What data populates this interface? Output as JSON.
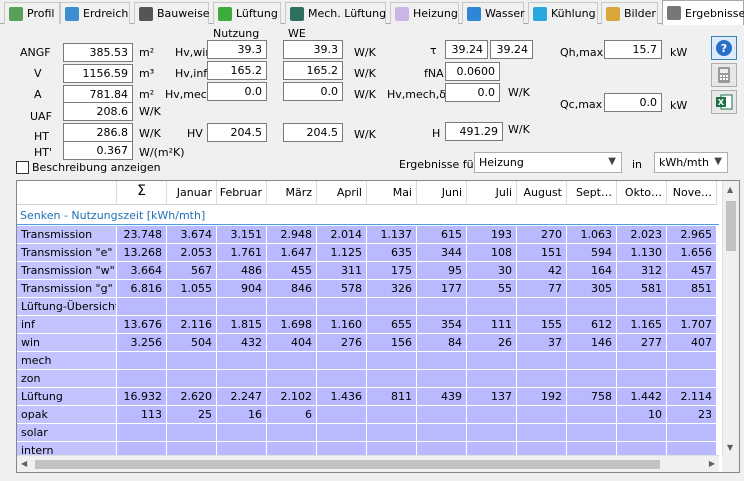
{
  "tabs": [
    {
      "name": "tab-profil",
      "label": "Profil",
      "icon": "profile-icon",
      "color": "#5aa05a"
    },
    {
      "name": "tab-erdreich",
      "label": "Erdreich",
      "icon": "earth-icon",
      "color": "#3e8ecf"
    },
    {
      "name": "tab-bauweise",
      "label": "Bauweise",
      "icon": "brick-wall-icon",
      "color": "#555555"
    },
    {
      "name": "tab-lueftung",
      "label": "Lüftung",
      "icon": "ventilation-icon",
      "color": "#3cab3c"
    },
    {
      "name": "tab-mech-lueftung",
      "label": "Mech. Lüftung",
      "icon": "fan-icon",
      "color": "#2f6f5f"
    },
    {
      "name": "tab-heizung",
      "label": "Heizung",
      "icon": "radiator-icon",
      "color": "#c9b6e6"
    },
    {
      "name": "tab-wasser",
      "label": "Wasser",
      "icon": "water-drop-icon",
      "color": "#2f86d6"
    },
    {
      "name": "tab-kuehlung",
      "label": "Kühlung",
      "icon": "snowflake-icon",
      "color": "#29a7e0"
    },
    {
      "name": "tab-bilder",
      "label": "Bilder",
      "icon": "palette-icon",
      "color": "#d9a63a"
    },
    {
      "name": "tab-ergebnisse",
      "label": "Ergebnisse",
      "icon": "calculator-icon",
      "color": "#777777",
      "active": true
    }
  ],
  "props": {
    "angf_label": "ANGF",
    "angf_value": "385.53",
    "angf_unit": "m²",
    "v_label": "V",
    "v_value": "1156.59",
    "v_unit": "m³",
    "a_label": "A",
    "a_value": "781.84",
    "a_unit": "m²",
    "uaf_label": "UAF",
    "uaf_value": "208.6",
    "uaf_unit": "W/K",
    "ht_label": "HT",
    "ht_value": "286.8",
    "ht_unit": "W/K",
    "htp_label": "HT'",
    "htp_value": "0.367",
    "htp_unit": "W/(m²K)"
  },
  "hv": {
    "nutzung_header": "Nutzung",
    "we_header": "WE",
    "win_label": "Hv,win",
    "win_nutzung": "39.3",
    "win_we": "39.3",
    "win_unit": "W/K",
    "inf_label": "Hv,inf",
    "inf_nutzung": "165.2",
    "inf_we": "165.2",
    "inf_unit": "W/K",
    "mech_label": "Hv,mech",
    "mech_nutzung": "0.0",
    "mech_we": "0.0",
    "mech_unit": "W/K",
    "hv_label": "HV",
    "hv_nutzung": "204.5",
    "hv_we": "204.5",
    "hv_unit": "W/K"
  },
  "right": {
    "tau_label": "τ",
    "tau_value1": "39.24",
    "tau_value2": "39.24",
    "fna_label": "fNA",
    "fna_value": "0.0600",
    "hvmech_label": "Hv,mech,δ",
    "hvmech_value": "0.0",
    "hvmech_unit": "W/K",
    "h_label": "H",
    "h_value": "491.29",
    "h_unit": "W/K",
    "qh_label": "Qh,max",
    "qh_value": "15.7",
    "qh_unit": "kW",
    "qc_label": "Qc,max",
    "qc_value": "0.0",
    "qc_unit": "kW"
  },
  "controls": {
    "beschreibung_label": "Beschreibung anzeigen",
    "ergebnisse_label": "Ergebnisse für",
    "ergebnisse_value": "Heizung",
    "in_label": "in",
    "unit_value": "kWh/mth"
  },
  "table": {
    "columns": [
      "Σ",
      "Januar",
      "Februar",
      "März",
      "April",
      "Mai",
      "Juni",
      "Juli",
      "August",
      "Sept…",
      "Okto…",
      "Nove…"
    ],
    "section": "Senken - Nutzungszeit  [kWh/mth]",
    "rows": [
      {
        "name": "Transmission",
        "values": [
          "23.748",
          "3.674",
          "3.151",
          "2.948",
          "2.014",
          "1.137",
          "615",
          "193",
          "270",
          "1.063",
          "2.023",
          "2.965"
        ]
      },
      {
        "name": "Transmission \"e\"",
        "values": [
          "13.268",
          "2.053",
          "1.761",
          "1.647",
          "1.125",
          "635",
          "344",
          "108",
          "151",
          "594",
          "1.130",
          "1.656"
        ]
      },
      {
        "name": "Transmission \"w\"",
        "values": [
          "3.664",
          "567",
          "486",
          "455",
          "311",
          "175",
          "95",
          "30",
          "42",
          "164",
          "312",
          "457"
        ]
      },
      {
        "name": "Transmission \"g\"",
        "values": [
          "6.816",
          "1.055",
          "904",
          "846",
          "578",
          "326",
          "177",
          "55",
          "77",
          "305",
          "581",
          "851"
        ]
      },
      {
        "name": "Lüftung-Übersicht",
        "values": [
          "",
          "",
          "",
          "",
          "",
          "",
          "",
          "",
          "",
          "",
          "",
          ""
        ]
      },
      {
        "name": "inf",
        "values": [
          "13.676",
          "2.116",
          "1.815",
          "1.698",
          "1.160",
          "655",
          "354",
          "111",
          "155",
          "612",
          "1.165",
          "1.707"
        ]
      },
      {
        "name": "win",
        "values": [
          "3.256",
          "504",
          "432",
          "404",
          "276",
          "156",
          "84",
          "26",
          "37",
          "146",
          "277",
          "407"
        ]
      },
      {
        "name": "mech",
        "values": [
          "",
          "",
          "",
          "",
          "",
          "",
          "",
          "",
          "",
          "",
          "",
          ""
        ]
      },
      {
        "name": "zon",
        "values": [
          "",
          "",
          "",
          "",
          "",
          "",
          "",
          "",
          "",
          "",
          "",
          ""
        ]
      },
      {
        "name": "Lüftung",
        "values": [
          "16.932",
          "2.620",
          "2.247",
          "2.102",
          "1.436",
          "811",
          "439",
          "137",
          "192",
          "758",
          "1.442",
          "2.114"
        ]
      },
      {
        "name": "opak",
        "values": [
          "113",
          "25",
          "16",
          "6",
          "",
          "",
          "",
          "",
          "",
          "",
          "10",
          "23"
        ]
      },
      {
        "name": "solar",
        "values": [
          "",
          "",
          "",
          "",
          "",
          "",
          "",
          "",
          "",
          "",
          "",
          ""
        ]
      },
      {
        "name": "intern",
        "values": [
          "",
          "",
          "",
          "",
          "",
          "",
          "",
          "",
          "",
          "",
          "",
          ""
        ]
      }
    ]
  }
}
